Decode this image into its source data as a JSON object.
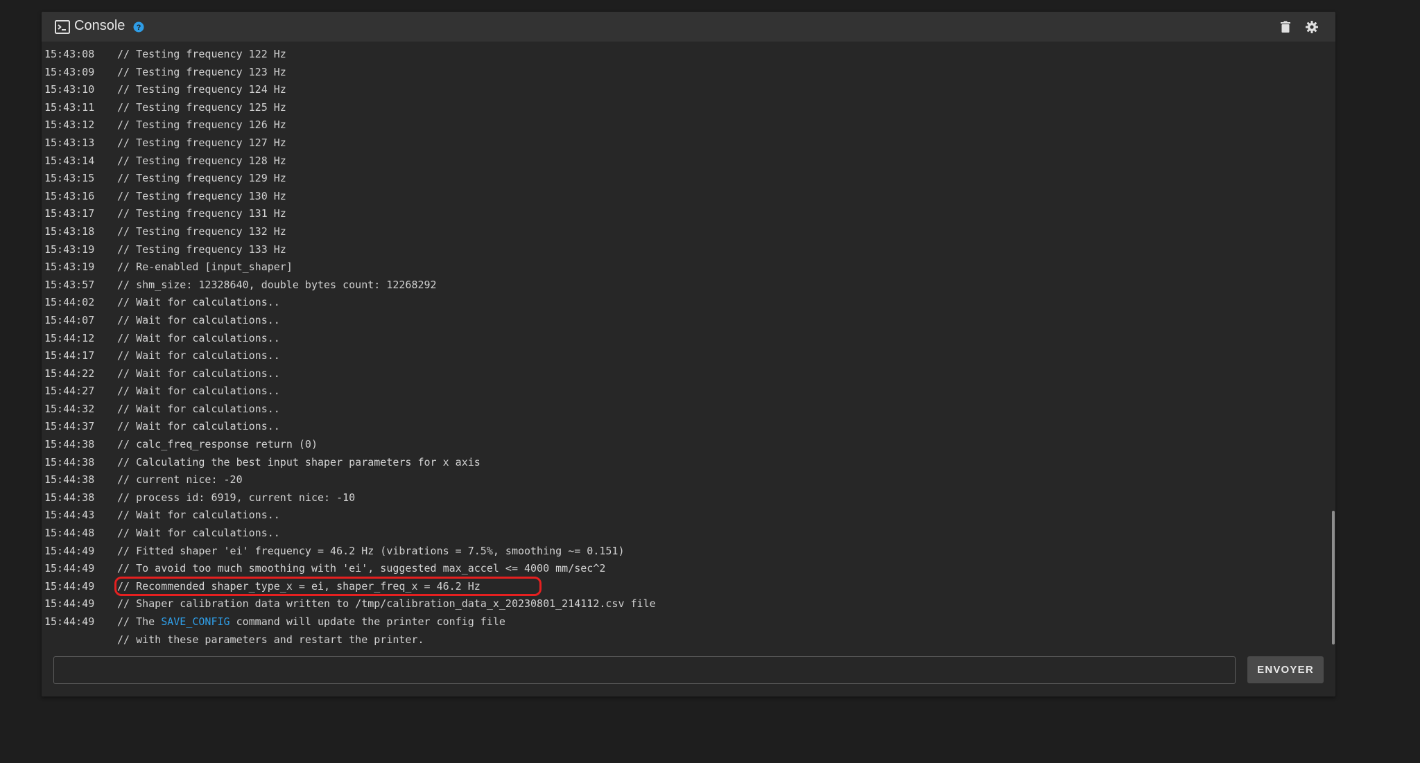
{
  "header": {
    "title": "Console",
    "console_icon": "terminal-icon",
    "help_icon": "help-circle-icon",
    "actions": [
      {
        "icon": "trash-icon",
        "name": "clear-console-button"
      },
      {
        "icon": "gear-icon",
        "name": "console-settings-button"
      }
    ]
  },
  "colors": {
    "background": "#1e1e1e",
    "card": "#272727",
    "header": "#333333",
    "text": "#d2d2d2",
    "link": "#2f9de6",
    "help": "#2f9de6",
    "highlight": "#e52020",
    "button": "#4a4a4a"
  },
  "log": [
    {
      "time": "15:43:08",
      "text": "// Testing frequency 122 Hz"
    },
    {
      "time": "15:43:09",
      "text": "// Testing frequency 123 Hz"
    },
    {
      "time": "15:43:10",
      "text": "// Testing frequency 124 Hz"
    },
    {
      "time": "15:43:11",
      "text": "// Testing frequency 125 Hz"
    },
    {
      "time": "15:43:12",
      "text": "// Testing frequency 126 Hz"
    },
    {
      "time": "15:43:13",
      "text": "// Testing frequency 127 Hz"
    },
    {
      "time": "15:43:14",
      "text": "// Testing frequency 128 Hz"
    },
    {
      "time": "15:43:15",
      "text": "// Testing frequency 129 Hz"
    },
    {
      "time": "15:43:16",
      "text": "// Testing frequency 130 Hz"
    },
    {
      "time": "15:43:17",
      "text": "// Testing frequency 131 Hz"
    },
    {
      "time": "15:43:18",
      "text": "// Testing frequency 132 Hz"
    },
    {
      "time": "15:43:19",
      "text": "// Testing frequency 133 Hz"
    },
    {
      "time": "15:43:19",
      "text": "// Re-enabled [input_shaper]"
    },
    {
      "time": "15:43:57",
      "text": "// shm_size: 12328640, double bytes count: 12268292"
    },
    {
      "time": "15:44:02",
      "text": "// Wait for calculations.."
    },
    {
      "time": "15:44:07",
      "text": "// Wait for calculations.."
    },
    {
      "time": "15:44:12",
      "text": "// Wait for calculations.."
    },
    {
      "time": "15:44:17",
      "text": "// Wait for calculations.."
    },
    {
      "time": "15:44:22",
      "text": "// Wait for calculations.."
    },
    {
      "time": "15:44:27",
      "text": "// Wait for calculations.."
    },
    {
      "time": "15:44:32",
      "text": "// Wait for calculations.."
    },
    {
      "time": "15:44:37",
      "text": "// Wait for calculations.."
    },
    {
      "time": "15:44:38",
      "text": "// calc_freq_response return (0)"
    },
    {
      "time": "15:44:38",
      "text": "// Calculating the best input shaper parameters for x axis"
    },
    {
      "time": "15:44:38",
      "text": "// current nice: -20"
    },
    {
      "time": "15:44:38",
      "text": "// process id: 6919, current nice: -10"
    },
    {
      "time": "15:44:43",
      "text": "// Wait for calculations.."
    },
    {
      "time": "15:44:48",
      "text": "// Wait for calculations.."
    },
    {
      "time": "15:44:49",
      "text": "// Fitted shaper 'ei' frequency = 46.2 Hz (vibrations = 7.5%, smoothing ~= 0.151)"
    },
    {
      "time": "15:44:49",
      "text": "// To avoid too much smoothing with 'ei', suggested max_accel <= 4000 mm/sec^2"
    },
    {
      "time": "15:44:49",
      "text": "// Recommended shaper_type_x = ei, shaper_freq_x = 46.2 Hz",
      "highlighted": true
    },
    {
      "time": "15:44:49",
      "text": "// Shaper calibration data written to /tmp/calibration_data_x_20230801_214112.csv file"
    },
    {
      "time": "15:44:49",
      "text_before": "// The ",
      "link": "SAVE_CONFIG",
      "text_after": " command will update the printer config file"
    },
    {
      "time": "",
      "text": "// with these parameters and restart the printer."
    }
  ],
  "input": {
    "value": "",
    "placeholder": ""
  },
  "send_button": {
    "label": "ENVOYER"
  }
}
